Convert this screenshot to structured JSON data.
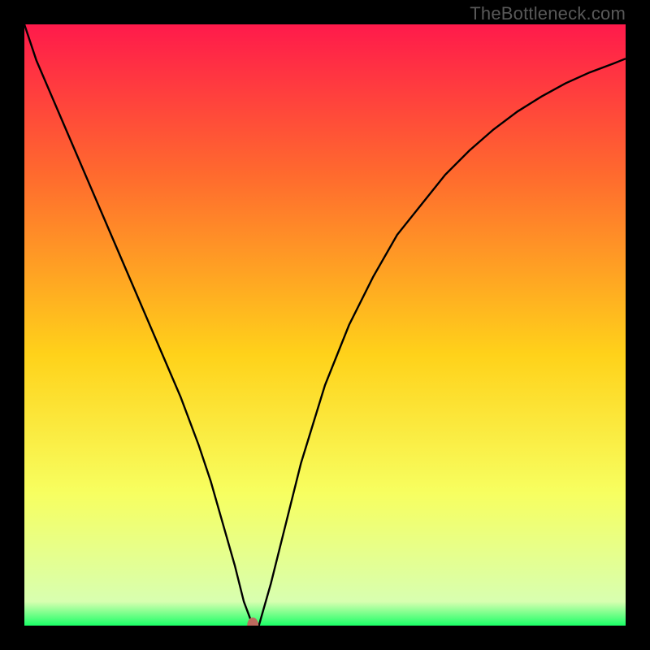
{
  "watermark": "TheBottleneck.com",
  "chart_data": {
    "type": "line",
    "title": "",
    "xlabel": "",
    "ylabel": "",
    "xlim": [
      0,
      100
    ],
    "ylim": [
      0,
      100
    ],
    "gradient_stops": [
      {
        "y": 0,
        "color": "#ff1a4b"
      },
      {
        "y": 25,
        "color": "#ff6a2e"
      },
      {
        "y": 55,
        "color": "#ffd21a"
      },
      {
        "y": 78,
        "color": "#f7ff60"
      },
      {
        "y": 96,
        "color": "#d8ffb0"
      },
      {
        "y": 100,
        "color": "#1aff66"
      }
    ],
    "series": [
      {
        "name": "bottleneck-curve",
        "color": "#000000",
        "x": [
          0,
          2,
          5,
          8,
          11,
          14,
          17,
          20,
          23,
          26,
          29,
          31,
          33,
          35,
          36.5,
          38,
          39,
          41,
          43,
          46,
          50,
          54,
          58,
          62,
          66,
          70,
          74,
          78,
          82,
          86,
          90,
          94,
          98,
          100
        ],
        "y": [
          100,
          94,
          87,
          80,
          73,
          66,
          59,
          52,
          45,
          38,
          30,
          24,
          17,
          10,
          4,
          0,
          0,
          7,
          15,
          27,
          40,
          50,
          58,
          65,
          70,
          75,
          79,
          82.5,
          85.5,
          88,
          90.2,
          92,
          93.5,
          94.3
        ]
      }
    ],
    "marker": {
      "name": "min-point",
      "x": 38,
      "y": 0,
      "color": "#bd6a5e",
      "rx": 7,
      "ry": 10
    }
  }
}
